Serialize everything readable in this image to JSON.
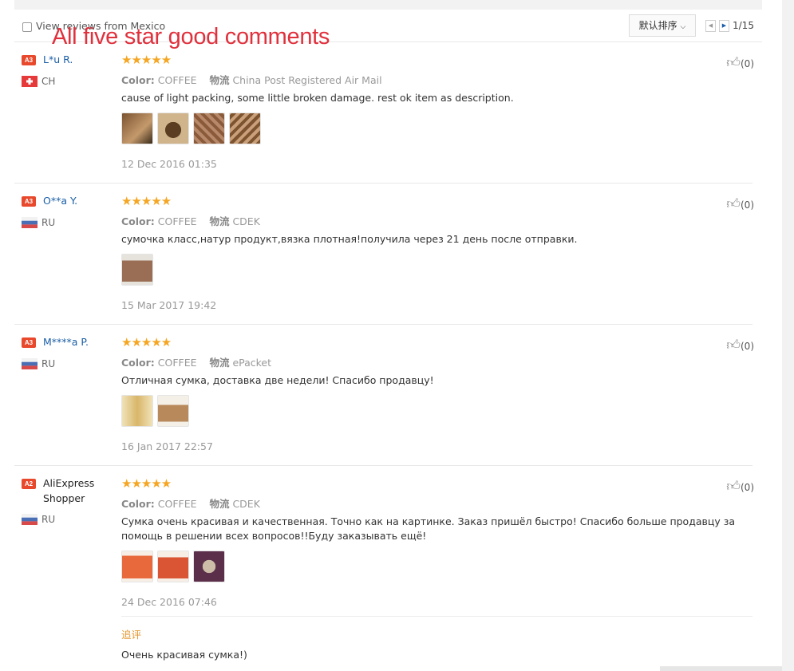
{
  "filter": {
    "checkbox_label": "View reviews from Mexico",
    "sort_label": "默认排序",
    "page_indicator": "1/15"
  },
  "watermark": "All five star good comments",
  "reviews": [
    {
      "badge": "A3",
      "name": "L*u R.",
      "country": "CH",
      "stars": "★★★★★",
      "color_label": "Color:",
      "color_value": "COFFEE",
      "logistics_label": "物流",
      "logistics_value": "China Post Registered Air Mail",
      "text": "cause of light packing, some little broken damage. rest ok item as description.",
      "date": "12 Dec 2016 01:35",
      "likes": "(0)"
    },
    {
      "badge": "A3",
      "name": "O**a Y.",
      "country": "RU",
      "stars": "★★★★★",
      "color_label": "Color:",
      "color_value": "COFFEE",
      "logistics_label": "物流",
      "logistics_value": "CDEK",
      "text": "сумочка класс,натур продукт,вязка плотная!получила через 21 день после отправки.",
      "date": "15 Mar 2017 19:42",
      "likes": "(0)"
    },
    {
      "badge": "A3",
      "name": "M****a P.",
      "country": "RU",
      "stars": "★★★★★",
      "color_label": "Color:",
      "color_value": "COFFEE",
      "logistics_label": "物流",
      "logistics_value": "ePacket",
      "text": "Отличная сумка, доставка две недели! Спасибо продавцу!",
      "date": "16 Jan 2017 22:57",
      "likes": "(0)"
    },
    {
      "badge": "A2",
      "name": "AliExpress Shopper",
      "country": "RU",
      "stars": "★★★★★",
      "color_label": "Color:",
      "color_value": "COFFEE",
      "logistics_label": "物流",
      "logistics_value": "CDEK",
      "text": "Сумка очень красивая и качественная. Точно как на картинке. Заказ пришёл быстро! Спасибо больше продавцу за помощь в решении всех вопросов!!Буду заказывать ещё!",
      "date": "24 Dec 2016 07:46",
      "likes": "(0)",
      "followup_label": "追评",
      "followup_text": "Очень красивая сумка!)"
    }
  ],
  "colors": {
    "star": "#f5a623",
    "badge": "#e8482b",
    "link": "#1a5ea6",
    "watermark": "#e0313d",
    "followup": "#e5962c"
  },
  "icons": {
    "like": "thumbs-up-icon",
    "prev": "arrow-left-icon",
    "next": "arrow-right-icon",
    "sort": "chevron-down-icon"
  }
}
